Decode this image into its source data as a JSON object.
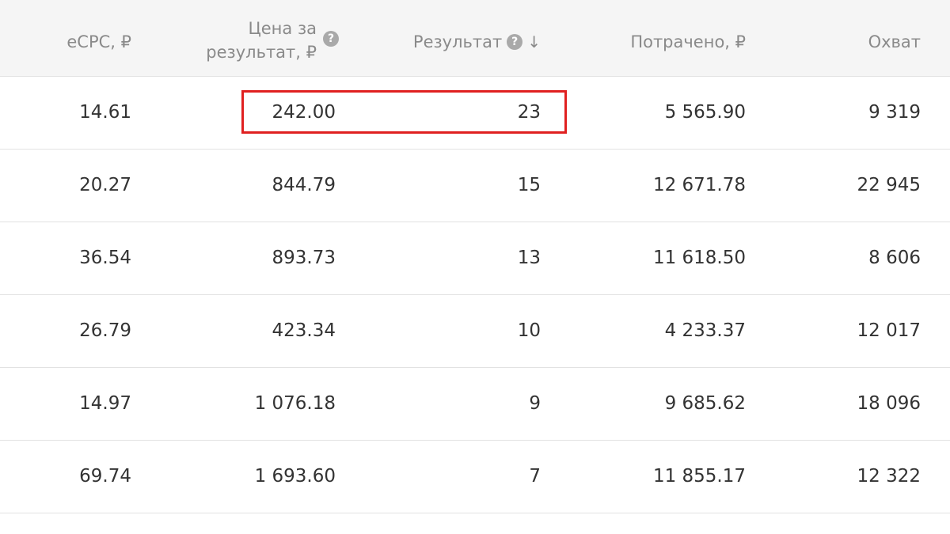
{
  "table": {
    "columns": {
      "ecpc": "eCPC, ₽",
      "cost_per_result_line1": "Цена за",
      "cost_per_result_line2": "результат, ₽",
      "result": "Результат",
      "spent": "Потрачено, ₽",
      "reach": "Охват"
    },
    "help_icon_glyph": "?",
    "sort_icon_glyph": "↓",
    "rows": [
      {
        "ecpc": "14.61",
        "cost_per_result": "242.00",
        "result": "23",
        "spent": "5 565.90",
        "reach": "9 319"
      },
      {
        "ecpc": "20.27",
        "cost_per_result": "844.79",
        "result": "15",
        "spent": "12 671.78",
        "reach": "22 945"
      },
      {
        "ecpc": "36.54",
        "cost_per_result": "893.73",
        "result": "13",
        "spent": "11 618.50",
        "reach": "8 606"
      },
      {
        "ecpc": "26.79",
        "cost_per_result": "423.34",
        "result": "10",
        "spent": "4 233.37",
        "reach": "12 017"
      },
      {
        "ecpc": "14.97",
        "cost_per_result": "1 076.18",
        "result": "9",
        "spent": "9 685.62",
        "reach": "18 096"
      },
      {
        "ecpc": "69.74",
        "cost_per_result": "1 693.60",
        "result": "7",
        "spent": "11 855.17",
        "reach": "12 322"
      }
    ],
    "sorted_by": "result",
    "sort_direction": "descending"
  },
  "highlight": {
    "color": "#e02020"
  },
  "colors": {
    "header_background": "#f5f5f5",
    "header_text": "#8a8a8a",
    "cell_text": "#333333",
    "divider": "#e2e2e2"
  }
}
